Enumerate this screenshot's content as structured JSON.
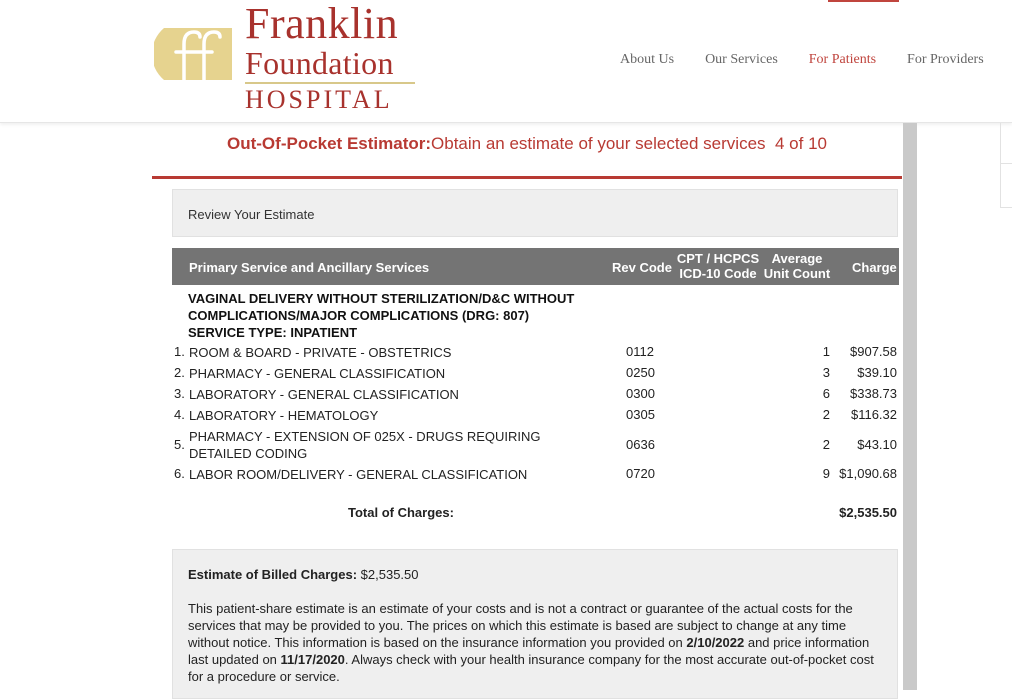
{
  "header": {
    "logo": {
      "line1": "Franklin",
      "line2": "Foundation",
      "line3": "HOSPITAL"
    },
    "nav": [
      {
        "label": "About Us",
        "active": false
      },
      {
        "label": "Our Services",
        "active": false
      },
      {
        "label": "For Patients",
        "active": true
      },
      {
        "label": "For Providers",
        "active": false
      }
    ]
  },
  "page": {
    "title_bold": "Out-Of-Pocket Estimator:",
    "title_rest": "Obtain an estimate of your selected services",
    "step": "4 of 10",
    "review_heading": "Review Your Estimate"
  },
  "table": {
    "headers": {
      "service": "Primary Service and Ancillary Services",
      "rev_code": "Rev Code",
      "cpt_line1": "CPT / HCPCS",
      "cpt_line2": "ICD-10 Code",
      "avg_line1": "Average",
      "avg_line2": "Unit Count",
      "charge": "Charge"
    },
    "service_title": "VAGINAL DELIVERY WITHOUT STERILIZATION/D&C WITHOUT COMPLICATIONS/MAJOR COMPLICATIONS (DRG: 807)",
    "service_type": "SERVICE TYPE: INPATIENT",
    "rows": [
      {
        "num": "1.",
        "desc": "ROOM & BOARD - PRIVATE - OBSTETRICS",
        "code": "0112",
        "count": "1",
        "charge": "$907.58"
      },
      {
        "num": "2.",
        "desc": "PHARMACY - GENERAL CLASSIFICATION",
        "code": "0250",
        "count": "3",
        "charge": "$39.10"
      },
      {
        "num": "3.",
        "desc": "LABORATORY - GENERAL CLASSIFICATION",
        "code": "0300",
        "count": "6",
        "charge": "$338.73"
      },
      {
        "num": "4.",
        "desc": "LABORATORY - HEMATOLOGY",
        "code": "0305",
        "count": "2",
        "charge": "$116.32"
      },
      {
        "num": "5.",
        "desc": "PHARMACY - EXTENSION OF 025X - DRUGS REQUIRING DETAILED CODING",
        "code": "0636",
        "count": "2",
        "charge": "$43.10"
      },
      {
        "num": "6.",
        "desc": "LABOR ROOM/DELIVERY - GENERAL CLASSIFICATION",
        "code": "0720",
        "count": "9",
        "charge": "$1,090.68"
      }
    ],
    "total_label": "Total of Charges:",
    "total_value": "$2,535.50"
  },
  "estimate": {
    "label": "Estimate of Billed Charges:",
    "value": "$2,535.50",
    "disclaimer_p1": "This patient-share estimate is an estimate of your costs and is not a contract or guarantee of the actual costs for the services that may be provided to you. The prices on which this estimate is based are subject to change at any time without notice. This information is based on the insurance information you provided on ",
    "insurance_date": "2/10/2022",
    "disclaimer_p2": " and price information last updated on ",
    "price_date": "11/17/2020",
    "disclaimer_p3": ". Always check with your health insurance company for the most accurate out-of-pocket cost for a procedure or service."
  },
  "colors": {
    "brand_red": "#b83a33",
    "logo_gold": "#e6d38f",
    "table_header": "#747474"
  }
}
